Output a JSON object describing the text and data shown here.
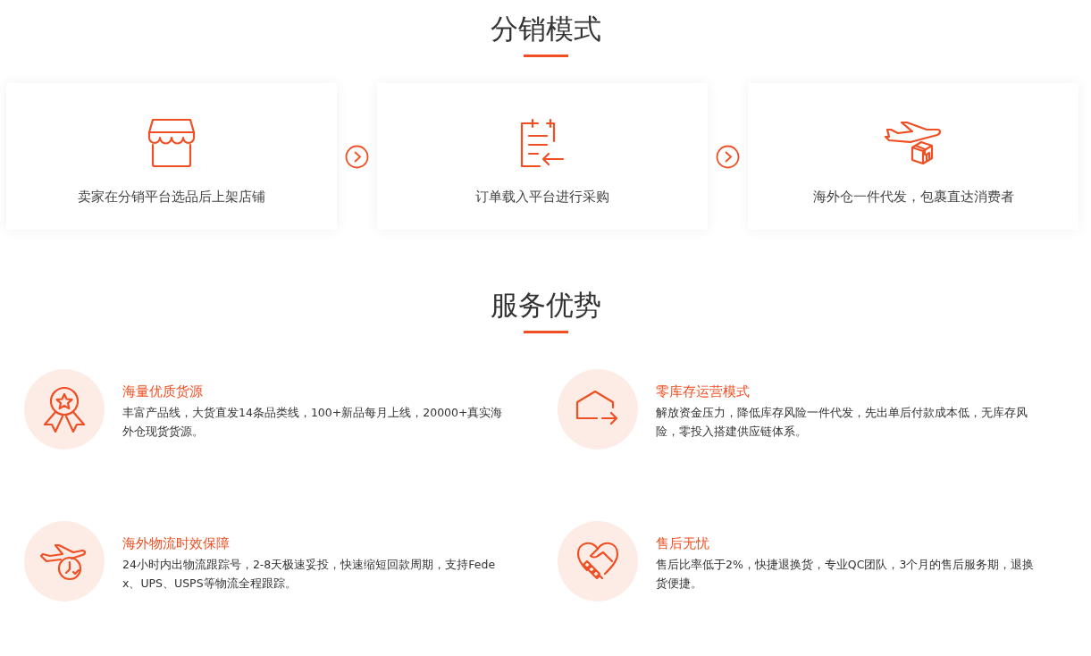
{
  "distribution": {
    "title": "分销模式",
    "steps": [
      {
        "text": "卖家在分销平台选品后上架店铺"
      },
      {
        "text": "订单载入平台进行采购"
      },
      {
        "text": "海外仓一件代发，包裹直达消费者"
      }
    ]
  },
  "advantages": {
    "title": "服务优势",
    "items": [
      {
        "title": "海量优质货源",
        "description": "丰富产品线，大货直发14条品类线，100+新品每月上线，20000+真实海外仓现货货源。"
      },
      {
        "title": "零库存运营模式",
        "description": "解放资金压力，降低库存风险一件代发，先出单后付款成本低，无库存风险，零投入搭建供应链体系。"
      },
      {
        "title": "海外物流时效保障",
        "description": "24小时内出物流跟踪号，2-8天极速妥投，快速缩短回款周期，支持Fedex、UPS、USPS等物流全程跟踪。"
      },
      {
        "title": "售后无忧",
        "description": "售后比率低于2%，快捷退换货，专业QC团队，3个月的售后服务期，退换货便捷。"
      }
    ]
  }
}
